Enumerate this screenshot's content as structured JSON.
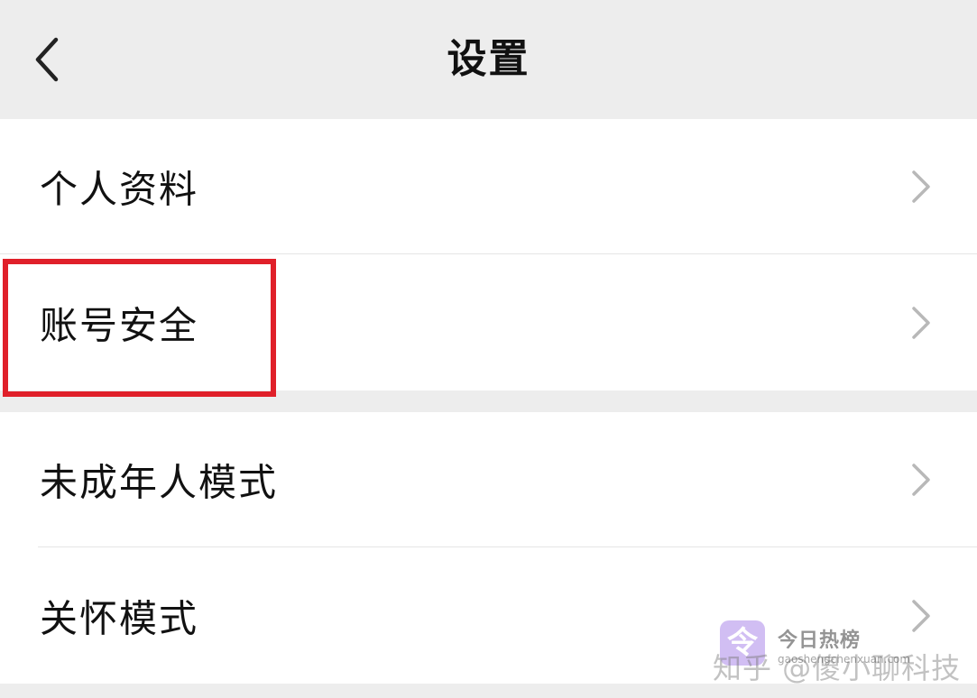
{
  "header": {
    "title": "设置",
    "back_icon": "chevron-left-icon"
  },
  "groups": [
    {
      "items": [
        {
          "label": "个人资料"
        },
        {
          "label": "账号安全",
          "highlighted": true
        }
      ]
    },
    {
      "items": [
        {
          "label": "未成年人模式"
        },
        {
          "label": "关怀模式"
        }
      ]
    }
  ],
  "highlight_color": "#e0202a",
  "watermark": {
    "logo_glyph": "令",
    "hot_label": "今日热榜",
    "zhihu_text": "知乎 @傻小聊科技",
    "url": "gaoshengchenxuan.com"
  }
}
